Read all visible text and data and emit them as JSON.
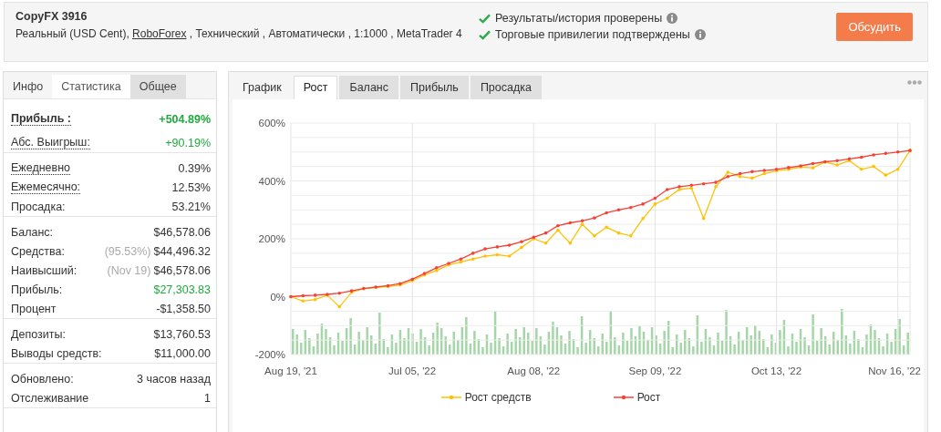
{
  "header": {
    "title": "CopyFX 3916",
    "description": {
      "before": "Реальный (USD Cent), ",
      "link": "RoboForex",
      "after": " , Технический , Автоматически , 1:1000 , MetaTrader 4"
    },
    "verifications": [
      {
        "text": "Результаты/история проверены",
        "checked": true
      },
      {
        "text": "Торговые привилегии подтверждены",
        "checked": true
      }
    ],
    "button": "Обсудить"
  },
  "stats_panel": {
    "tabs": [
      {
        "label": "Инфо",
        "selected": false
      },
      {
        "label": "Статистика",
        "selected": true
      },
      {
        "label": "Общее",
        "selected": false
      }
    ],
    "sections": [
      {
        "rows": [
          {
            "label": "Прибыль :",
            "value": "+504.89%",
            "bold": true,
            "underlined": true,
            "positive": true
          },
          {
            "label": "Абс. Выигрыш:",
            "value": "+90.19%",
            "bold": false,
            "underlined": true,
            "positive": true
          }
        ]
      },
      {
        "rows": [
          {
            "label": "Ежедневно",
            "value": "0.39%",
            "bold": false,
            "underlined": true,
            "positive": false
          },
          {
            "label": "Ежемесячно:",
            "value": "12.53%",
            "bold": false,
            "underlined": true,
            "positive": false
          },
          {
            "label": "Просадка:",
            "value": "53.21%",
            "bold": false,
            "underlined": false,
            "positive": false
          }
        ]
      },
      {
        "rows": [
          {
            "label": "Баланс:",
            "value": "$46,578.06",
            "bold": false,
            "underlined": false,
            "positive": false
          },
          {
            "label": "Средства:",
            "note": "(95.53%)",
            "value": "$44,496.32",
            "bold": false,
            "underlined": false,
            "positive": false
          },
          {
            "label": "Наивысший:",
            "note": "(Nov 19)",
            "value": "$46,578.06",
            "bold": false,
            "underlined": false,
            "positive": false
          },
          {
            "label": "Прибыль:",
            "value": "$27,303.83",
            "bold": false,
            "underlined": false,
            "positive": true
          },
          {
            "label": "Процент",
            "value": "-$1,358.50",
            "bold": false,
            "underlined": false,
            "positive": false
          }
        ]
      },
      {
        "rows": [
          {
            "label": "Депозиты:",
            "value": "$13,760.53",
            "bold": false,
            "underlined": false,
            "positive": false
          },
          {
            "label": "Выводы средств:",
            "value": "$11,000.00",
            "bold": false,
            "underlined": false,
            "positive": false
          }
        ]
      },
      {
        "rows": [
          {
            "label": "Обновлено:",
            "value": "3 часов назад",
            "bold": false,
            "underlined": false,
            "positive": false
          },
          {
            "label": "Отслеживание",
            "value": "1",
            "bold": false,
            "underlined": false,
            "positive": false
          }
        ]
      }
    ]
  },
  "chart_panel": {
    "tabs": [
      {
        "label": "График",
        "selected": false
      },
      {
        "label": "Рост",
        "selected": true
      },
      {
        "label": "Баланс",
        "selected": false
      },
      {
        "label": "Прибыль",
        "selected": false
      },
      {
        "label": "Просадка",
        "selected": false
      }
    ],
    "chart_data": {
      "type": "line",
      "grid": true,
      "legend": true,
      "categories": [
        "Aug 19, '21",
        null,
        null,
        null,
        null,
        null,
        null,
        null,
        null,
        null,
        "Jul 05, '22",
        null,
        null,
        null,
        null,
        null,
        null,
        null,
        null,
        null,
        "Aug 08, '22",
        null,
        null,
        null,
        null,
        null,
        null,
        null,
        null,
        null,
        "Sep 09, '22",
        null,
        null,
        null,
        null,
        null,
        null,
        null,
        null,
        null,
        "Oct 13, '22",
        null,
        null,
        null,
        null,
        null,
        null,
        null,
        null,
        null,
        "Nov 16, '22",
        null
      ],
      "ylim": [
        -200,
        600
      ],
      "yticks": [
        {
          "value": -200,
          "label": "-200%"
        },
        {
          "value": 0,
          "label": "0%"
        },
        {
          "value": 200,
          "label": "200%"
        },
        {
          "value": 400,
          "label": "400%"
        },
        {
          "value": 600,
          "label": "600%"
        }
      ],
      "series": [
        {
          "name": "Рост средств",
          "color": "#ffc107",
          "values": [
            0,
            -15,
            -10,
            5,
            -35,
            15,
            28,
            32,
            35,
            40,
            55,
            75,
            90,
            110,
            120,
            130,
            140,
            145,
            140,
            170,
            200,
            185,
            230,
            185,
            250,
            210,
            240,
            220,
            210,
            270,
            320,
            340,
            370,
            375,
            270,
            380,
            430,
            415,
            410,
            425,
            435,
            440,
            448,
            445,
            465,
            455,
            470,
            440,
            450,
            420,
            440,
            505
          ]
        },
        {
          "name": "Рост",
          "color": "#f44336",
          "values": [
            0,
            3,
            5,
            8,
            12,
            20,
            28,
            33,
            38,
            45,
            60,
            80,
            100,
            115,
            130,
            150,
            165,
            172,
            178,
            190,
            205,
            220,
            245,
            255,
            262,
            272,
            290,
            300,
            308,
            320,
            340,
            370,
            380,
            385,
            390,
            395,
            415,
            425,
            432,
            436,
            440,
            446,
            452,
            460,
            466,
            470,
            476,
            482,
            490,
            495,
            500,
            505
          ]
        }
      ]
    }
  }
}
